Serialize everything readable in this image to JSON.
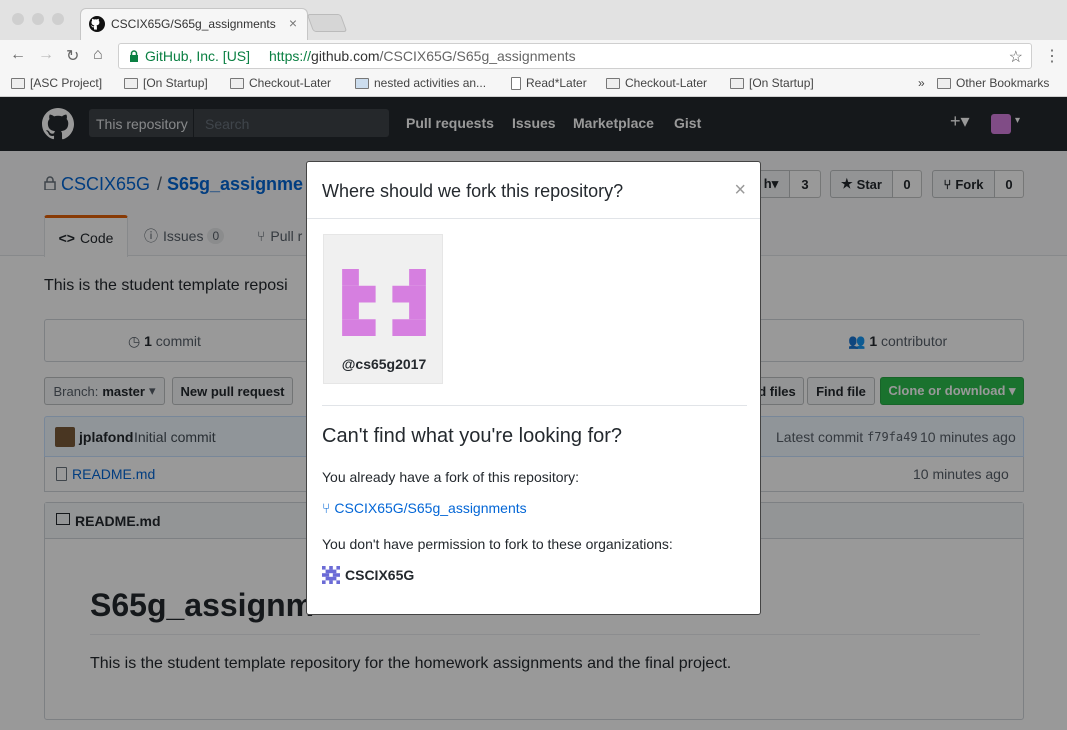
{
  "browser": {
    "tab_title": "CSCIX65G/S65g_assignments",
    "tab_close": "×",
    "security_label": "GitHub, Inc. [US]",
    "url_protocol": "https://",
    "url_host": "github.com",
    "url_path": "/CSCIX65G/S65g_assignments",
    "bookmarks": [
      "[ASC Project]",
      "[On Startup]",
      "Checkout-Later",
      "nested activities an...",
      "Read*Later",
      "Checkout-Later",
      "[On Startup]"
    ],
    "bookmarks_overflow": "»",
    "other_bookmarks": "Other Bookmarks"
  },
  "github_header": {
    "scope_label": "This repository",
    "search_placeholder": "Search",
    "nav": [
      "Pull requests",
      "Issues",
      "Marketplace",
      "Gist"
    ],
    "plus": "+▾"
  },
  "repo": {
    "owner": "CSCIX65G",
    "slash": "/",
    "name": "S65g_assignme",
    "watch_suffix": "h▾",
    "watch_count": "3",
    "star_label": "Star",
    "star_count": "0",
    "fork_label": "Fork",
    "fork_count": "0",
    "tabs": {
      "code": "Code",
      "issues": "Issues",
      "issues_count": "0",
      "pull": "Pull r"
    },
    "description": "This is the student template reposi",
    "commits_count": "1",
    "commits_label": "commit",
    "contributors_count": "1",
    "contributors_label": "contributor",
    "branch_label": "Branch:",
    "branch_name": "master",
    "new_pr": "New pull request",
    "upload_files": "d files",
    "find_file": "Find file",
    "clone": "Clone or download ▾",
    "commit_author": "jplafond",
    "commit_message": "Initial commit",
    "latest_commit_label": "Latest commit",
    "commit_sha": "f79fa49",
    "commit_time": "10 minutes ago",
    "file_name": "README.md",
    "file_time": "10 minutes ago",
    "readme_header": "README.md",
    "readme_title": "S65g_assignm",
    "readme_body": "This is the student template repository for the homework assignments and the final project."
  },
  "modal": {
    "title": "Where should we fork this repository?",
    "close": "×",
    "account": "@cs65g2017",
    "cant_find": "Can't find what you're looking for?",
    "already_fork": "You already have a fork of this repository:",
    "fork_link": "CSCIX65G/S65g_assignments",
    "no_permission": "You don't have permission to fork to these organizations:",
    "org_name": "CSCIX65G"
  },
  "colors": {
    "avatar_pink": "#d67fe0",
    "clone_green": "#2cbe4e",
    "link_blue": "#0366d6",
    "header_dark": "#24292e"
  }
}
